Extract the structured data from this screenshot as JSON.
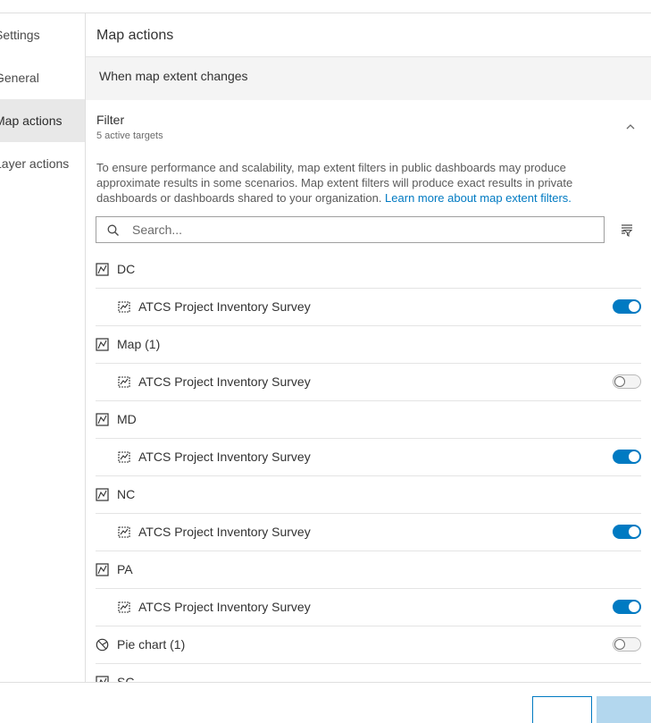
{
  "sidebar": {
    "items": [
      {
        "label": "Settings"
      },
      {
        "label": "General"
      },
      {
        "label": "Map actions"
      },
      {
        "label": "Layer actions"
      }
    ]
  },
  "main": {
    "title": "Map actions",
    "section_label": "When map extent changes",
    "filter": {
      "title": "Filter",
      "subtitle": "5 active targets",
      "info_text": "To ensure performance and scalability, map extent filters in public dashboards may produce approximate results in some scenarios. Map extent filters will produce exact results in private dashboards or dashboards shared to your organization. ",
      "info_link": "Learn more about map extent filters.",
      "search_placeholder": "Search..."
    },
    "targets": [
      {
        "label": "DC",
        "icon": "map-icon"
      },
      {
        "label": "ATCS Project Inventory Survey",
        "icon": "layer-icon",
        "enabled": true
      },
      {
        "label": "Map (1)",
        "icon": "map-icon"
      },
      {
        "label": "ATCS Project Inventory Survey",
        "icon": "layer-icon",
        "enabled": false
      },
      {
        "label": "MD",
        "icon": "map-icon"
      },
      {
        "label": "ATCS Project Inventory Survey",
        "icon": "layer-icon",
        "enabled": true
      },
      {
        "label": "NC",
        "icon": "map-icon"
      },
      {
        "label": "ATCS Project Inventory Survey",
        "icon": "layer-icon",
        "enabled": true
      },
      {
        "label": "PA",
        "icon": "map-icon"
      },
      {
        "label": "ATCS Project Inventory Survey",
        "icon": "layer-icon",
        "enabled": true
      },
      {
        "label": "Pie chart (1)",
        "icon": "pie-chart-icon",
        "enabled": false
      },
      {
        "label": "SC",
        "icon": "map-icon"
      }
    ]
  },
  "colors": {
    "accent": "#007ac2",
    "active_nav_bg": "#e8e8e8",
    "section_bg": "#f4f4f4"
  }
}
